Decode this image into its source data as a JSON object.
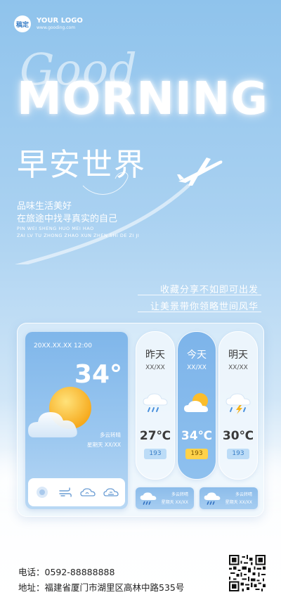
{
  "logo": {
    "badge": "稿定",
    "name": "YOUR LOGO",
    "url": "www.gooding.com"
  },
  "hero": {
    "good": "Good",
    "morning": "MORNING",
    "title_cn": "早安世界"
  },
  "slogan": {
    "line1": "品味生活美好",
    "line2": "在旅途中找寻真实的自己",
    "pinyin1": "PIN WEI SHENG HUO MEI HAO",
    "pinyin2": "ZAI LV TU ZHONG ZHAO XUN ZHEN SHI DE ZI JI"
  },
  "tagline": {
    "line1": "收藏分享不如即可出发",
    "line2": "让美景带你领略世间风华"
  },
  "today": {
    "datetime": "20XX.XX.XX  12:00",
    "temperature": "34°",
    "condition": "多云转晴",
    "weekday": "星期天  XX/XX",
    "icons": [
      "location-icon",
      "wind-icon",
      "humidity-icon",
      "sunrise-icon"
    ]
  },
  "forecast": [
    {
      "name": "昨天",
      "date": "XX/XX",
      "temp": "27℃",
      "aqi": "193",
      "icon": "rain-cloud-icon"
    },
    {
      "name": "今天",
      "date": "XX/XX",
      "temp": "34℃",
      "aqi": "193",
      "icon": "sun-cloud-icon"
    },
    {
      "name": "明天",
      "date": "XX/XX",
      "temp": "30℃",
      "aqi": "193",
      "icon": "thunder-cloud-icon"
    }
  ],
  "mini_cards": [
    {
      "condition": "多云转晴",
      "date": "星期天  XX/XX",
      "icon": "rain-cloud-icon"
    },
    {
      "condition": "多云转晴",
      "date": "星期天  XX/XX",
      "icon": "rain-cloud-icon"
    }
  ],
  "contact": {
    "phone": "电话：0592-88888888",
    "address": "地址：福建省厦门市湖里区高林中路535号"
  },
  "colors": {
    "accent": "#7fb6ea",
    "aqi_active": "#ffd24a",
    "aqi": "#bcdcf7"
  }
}
